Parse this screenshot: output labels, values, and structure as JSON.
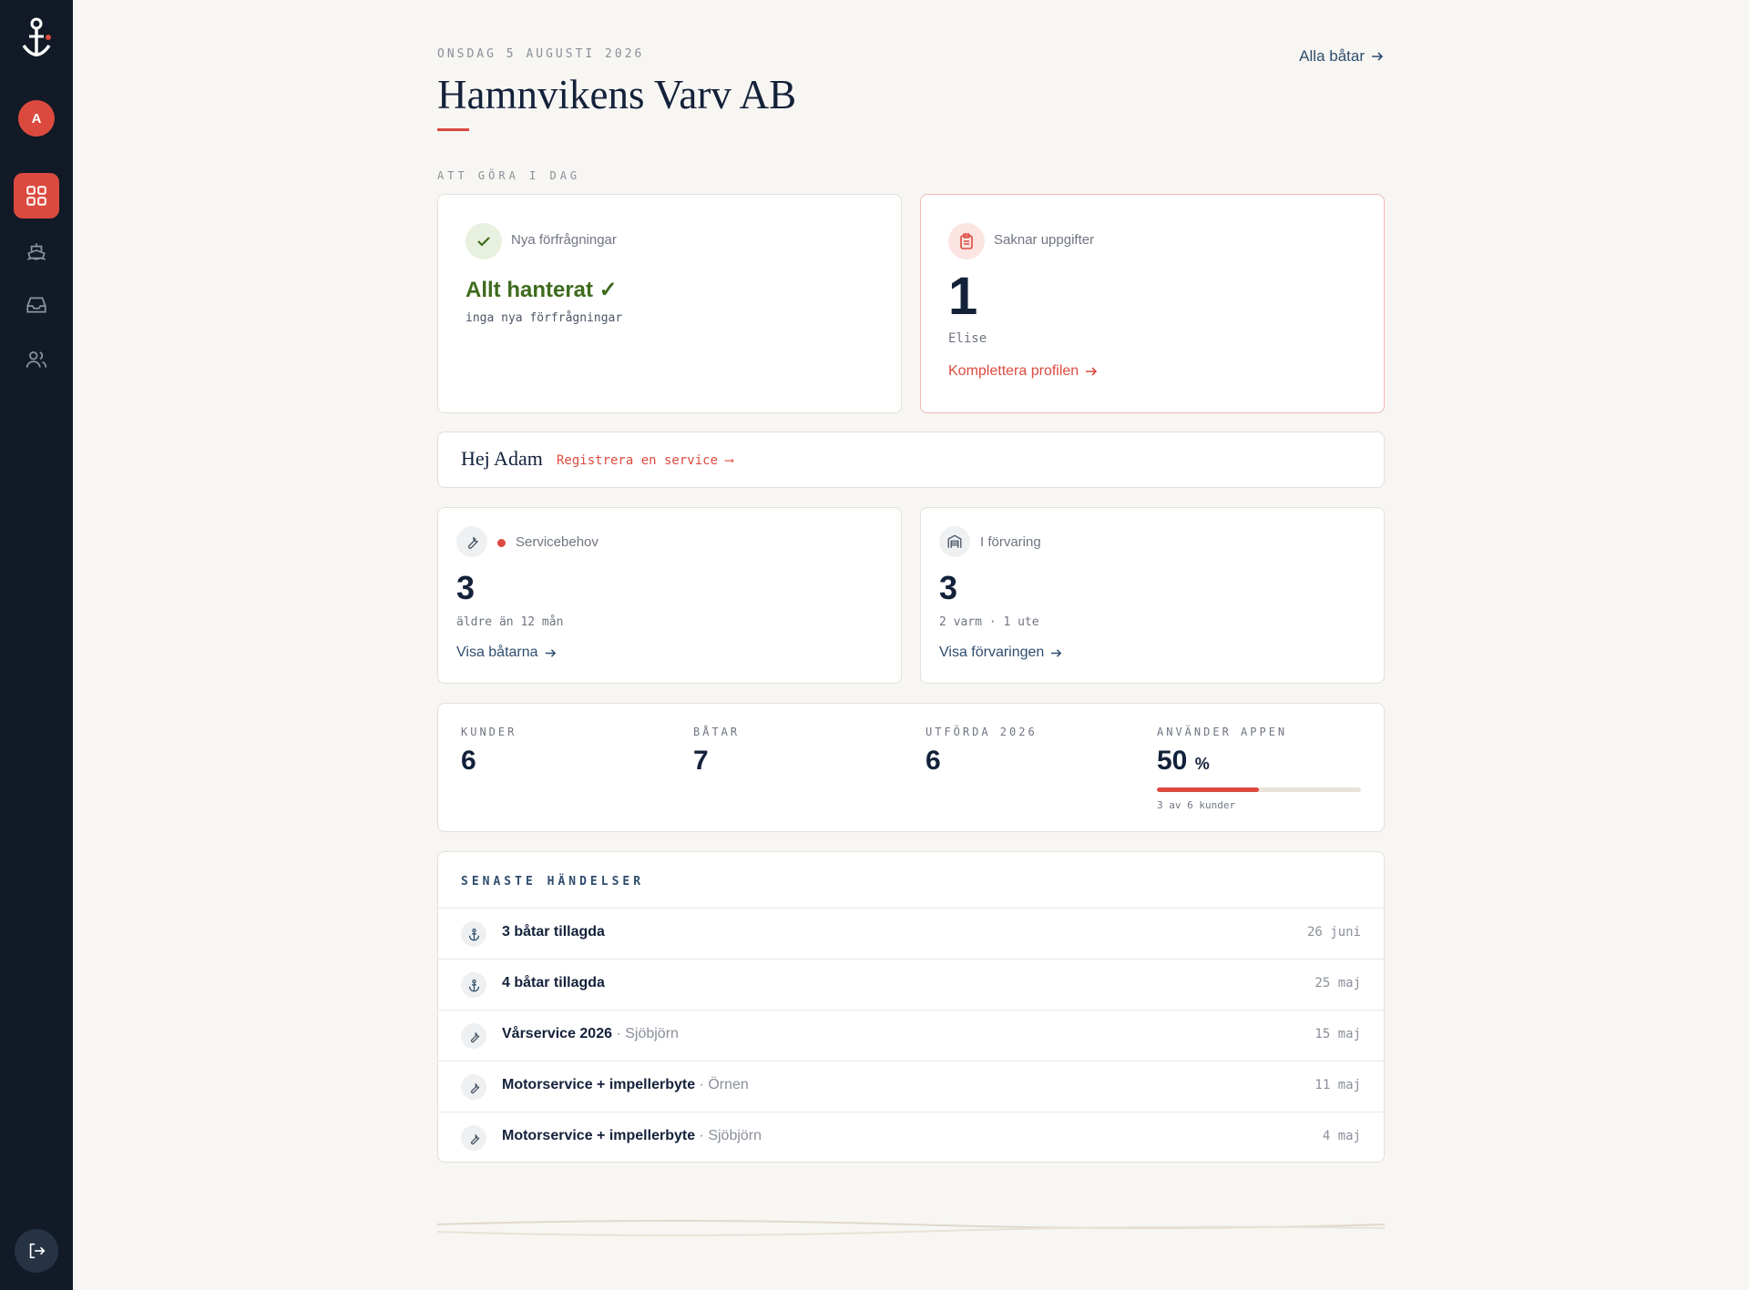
{
  "header": {
    "date": "ONSDAG 5 AUGUSTI 2026",
    "title": "Hamnvikens Varv AB",
    "all_boats_link": "Alla båtar"
  },
  "sidebar": {
    "avatar_initial": "A",
    "items": [
      {
        "icon": "dashboard-grid-icon",
        "active": true
      },
      {
        "icon": "boat-icon",
        "active": false
      },
      {
        "icon": "inbox-icon",
        "active": false
      },
      {
        "icon": "users-icon",
        "active": false
      }
    ],
    "logout_icon": "logout-icon"
  },
  "todo": {
    "section_label": "ATT GÖRA I DAG",
    "requests": {
      "label": "Nya förfrågningar",
      "status": "Allt hanterat ✓",
      "sub": "inga nya förfrågningar"
    },
    "missing": {
      "label": "Saknar uppgifter",
      "count": "1",
      "name": "Elise",
      "link": "Komplettera profilen"
    }
  },
  "greeting": {
    "text": "Hej Adam",
    "link": "Registrera en service ⟶"
  },
  "service": {
    "label": "Servicebehov",
    "count": "3",
    "sub": "äldre än 12 mån",
    "link": "Visa båtarna"
  },
  "storage": {
    "label": "I förvaring",
    "count": "3",
    "sub": "2 varm · 1 ute",
    "link": "Visa förvaringen"
  },
  "stats": {
    "customers_label": "KUNDER",
    "customers": "6",
    "boats_label": "BÅTAR",
    "boats": "7",
    "done_label": "UTFÖRDA 2026",
    "done": "6",
    "app_label": "ANVÄNDER APPEN",
    "app_value": "50",
    "app_unit": "%",
    "app_fraction": 0.5,
    "app_sub": "3 av 6 kunder"
  },
  "events": {
    "title": "SENASTE HÄNDELSER",
    "items": [
      {
        "icon": "anchor-icon",
        "title": "3 båtar tillagda",
        "sub": "",
        "date": "26 juni"
      },
      {
        "icon": "anchor-icon",
        "title": "4 båtar tillagda",
        "sub": "",
        "date": "25 maj"
      },
      {
        "icon": "wrench-icon",
        "title": "Vårservice 2026",
        "sub": "· Sjöbjörn",
        "date": "15 maj"
      },
      {
        "icon": "wrench-icon",
        "title": "Motorservice + impellerbyte",
        "sub": "· Örnen",
        "date": "11 maj"
      },
      {
        "icon": "wrench-icon",
        "title": "Motorservice + impellerbyte",
        "sub": "· Sjöbjörn",
        "date": "4 maj"
      }
    ]
  },
  "colors": {
    "accent": "#dc4a3f",
    "sidebar": "#111a26",
    "navy": "#13213a",
    "success": "#3f6b1e",
    "link": "#2f4d6e"
  }
}
